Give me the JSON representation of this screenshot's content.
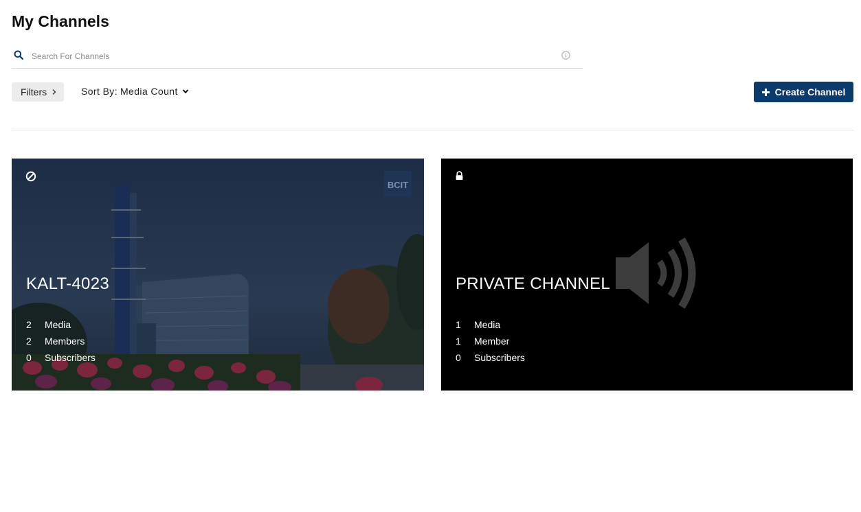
{
  "page": {
    "title": "My Channels"
  },
  "search": {
    "placeholder": "Search For Channels",
    "value": ""
  },
  "toolbar": {
    "filters_label": "Filters",
    "sort_label": "Sort By:",
    "sort_value": "Media Count",
    "create_label": "Create Channel",
    "accent_color": "#0c3a6b"
  },
  "channels": [
    {
      "name": "KALT-4023",
      "status_icon": "restricted-icon",
      "logo_text": "BCIT",
      "stats": [
        {
          "count": "2",
          "label": "Media"
        },
        {
          "count": "2",
          "label": "Members"
        },
        {
          "count": "0",
          "label": "Subscribers"
        }
      ]
    },
    {
      "name": "PRIVATE CHANNEL",
      "status_icon": "lock-icon",
      "thumbnail_icon": "speaker-icon",
      "stats": [
        {
          "count": "1",
          "label": "Media"
        },
        {
          "count": "1",
          "label": "Member"
        },
        {
          "count": "0",
          "label": "Subscribers"
        }
      ]
    }
  ]
}
